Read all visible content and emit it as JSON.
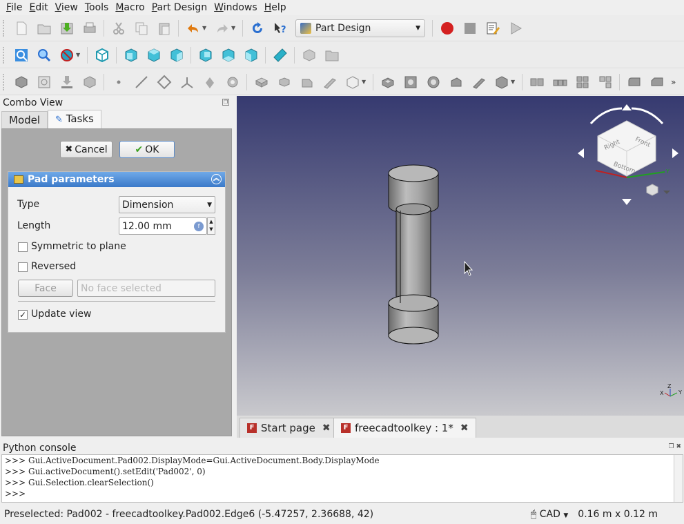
{
  "menubar": {
    "items": [
      "File",
      "Edit",
      "View",
      "Tools",
      "Macro",
      "Part Design",
      "Windows",
      "Help"
    ]
  },
  "toolbar": {
    "workbench": "Part Design"
  },
  "combo_view": {
    "title": "Combo View",
    "tabs": [
      "Model",
      "Tasks"
    ],
    "cancel_label": "Cancel",
    "ok_label": "OK",
    "pad_panel": {
      "title": "Pad parameters",
      "type_label": "Type",
      "type_value": "Dimension",
      "length_label": "Length",
      "length_value": "12.00 mm",
      "symmetric_label": "Symmetric to plane",
      "reversed_label": "Reversed",
      "face_button": "Face",
      "face_placeholder": "No face selected",
      "update_view_label": "Update view",
      "update_view_checked": "✓"
    }
  },
  "navcube": {
    "faces": [
      "Right",
      "Front",
      "Bottom"
    ],
    "axes": [
      "X",
      "Y",
      "Z"
    ]
  },
  "doc_tabs": [
    {
      "label": "Start page"
    },
    {
      "label": "freecadtoolkey : 1*"
    }
  ],
  "console": {
    "title": "Python console",
    "lines": [
      ">>> Gui.ActiveDocument.Pad002.DisplayMode=Gui.ActiveDocument.Body.DisplayMode",
      ">>> Gui.activeDocument().setEdit('Pad002', 0)",
      ">>> Gui.Selection.clearSelection()",
      ">>> "
    ]
  },
  "statusbar": {
    "message": "Preselected: Pad002 - freecadtoolkey.Pad002.Edge6 (-5.47257, 2.36688, 42)",
    "nav_style": "CAD",
    "dimensions": "0.16 m x 0.12 m"
  },
  "colors": {
    "accent": "#3a79c9",
    "record": "#d42020",
    "viewport_top": "#363a70",
    "viewport_bottom": "#c9c9cd"
  }
}
